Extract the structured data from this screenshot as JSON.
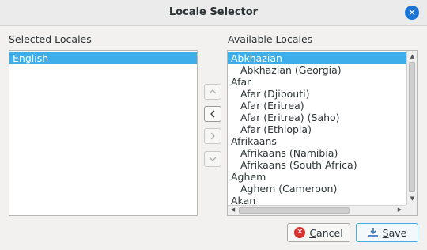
{
  "window": {
    "title": "Locale Selector"
  },
  "selected": {
    "label": "Selected Locales",
    "items": [
      {
        "label": "English",
        "selected": true
      }
    ]
  },
  "available": {
    "label": "Available Locales",
    "items": [
      {
        "label": "Abkhazian",
        "child": false,
        "selected": true
      },
      {
        "label": "Abkhazian (Georgia)",
        "child": true
      },
      {
        "label": "Afar",
        "child": false
      },
      {
        "label": "Afar (Djibouti)",
        "child": true
      },
      {
        "label": "Afar (Eritrea)",
        "child": true
      },
      {
        "label": "Afar (Eritrea) (Saho)",
        "child": true
      },
      {
        "label": "Afar (Ethiopia)",
        "child": true
      },
      {
        "label": "Afrikaans",
        "child": false
      },
      {
        "label": "Afrikaans (Namibia)",
        "child": true
      },
      {
        "label": "Afrikaans (South Africa)",
        "child": true
      },
      {
        "label": "Aghem",
        "child": false
      },
      {
        "label": "Aghem (Cameroon)",
        "child": true
      },
      {
        "label": "Akan",
        "child": false
      }
    ]
  },
  "buttons": {
    "cancel_mnemonic": "C",
    "cancel_rest": "ancel",
    "save_mnemonic": "S",
    "save_rest": "ave"
  },
  "icons": {
    "move_up": "chevron-up-icon",
    "move_left": "chevron-left-icon",
    "move_right": "chevron-right-icon",
    "move_down": "chevron-down-icon",
    "close": "close-icon",
    "cancel": "cancel-icon",
    "save": "save-icon"
  },
  "colors": {
    "accent": "#3daee9",
    "close_button": "#1a74d6",
    "cancel_icon": "#d8322e"
  }
}
